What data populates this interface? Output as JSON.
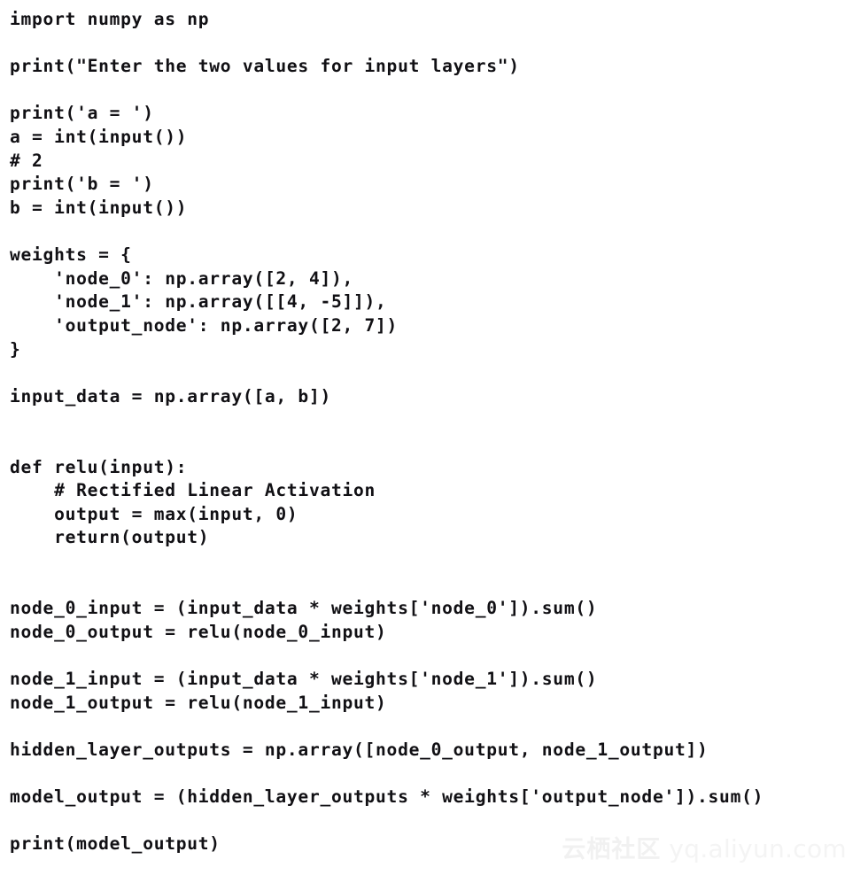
{
  "page": {
    "background_color": "#ffffff",
    "text_color": "#111014",
    "language": "python"
  },
  "code": {
    "lines": [
      "import numpy as np",
      "",
      "print(\"Enter the two values for input layers\")",
      "",
      "print('a = ')",
      "a = int(input())",
      "# 2",
      "print('b = ')",
      "b = int(input())",
      "",
      "weights = {",
      "    'node_0': np.array([2, 4]),",
      "    'node_1': np.array([[4, -5]]),",
      "    'output_node': np.array([2, 7])",
      "}",
      "",
      "input_data = np.array([a, b])",
      "",
      "",
      "def relu(input):",
      "    # Rectified Linear Activation",
      "    output = max(input, 0)",
      "    return(output)",
      "",
      "",
      "node_0_input = (input_data * weights['node_0']).sum()",
      "node_0_output = relu(node_0_input)",
      "",
      "node_1_input = (input_data * weights['node_1']).sum()",
      "node_1_output = relu(node_1_input)",
      "",
      "hidden_layer_outputs = np.array([node_0_output, node_1_output])",
      "",
      "model_output = (hidden_layer_outputs * weights['output_node']).sum()",
      "",
      "print(model_output)"
    ]
  },
  "watermark": {
    "brand_cn": "云栖社区",
    "url": "yq.aliyun.com",
    "color": "#f2f2f2"
  }
}
